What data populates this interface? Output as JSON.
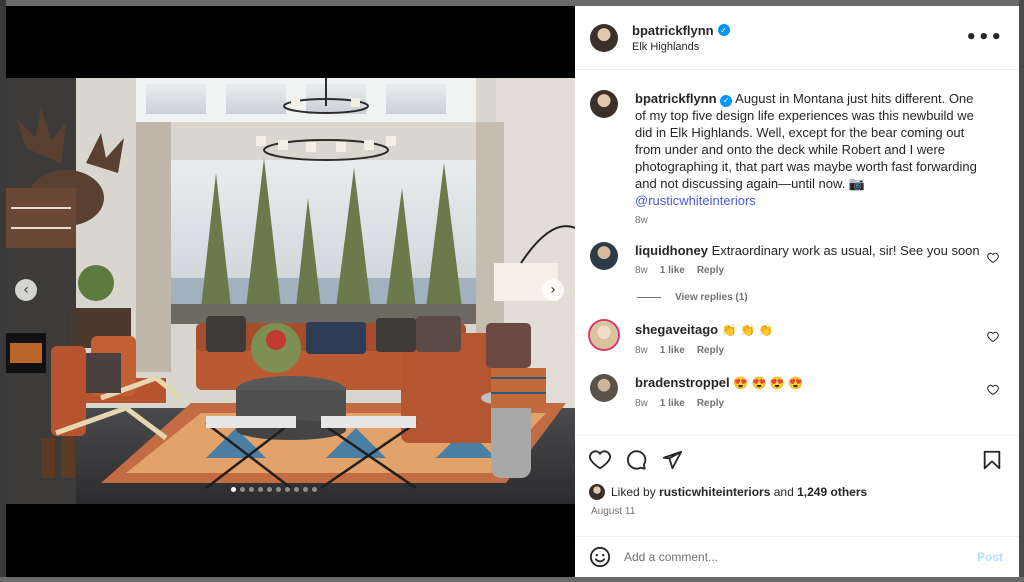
{
  "post": {
    "username": "bpatrickflynn",
    "location": "Elk Highlands",
    "more_icon": "more-horizontal-icon"
  },
  "caption": {
    "username": "bpatrickflynn",
    "text": "August in Montana just hits different. One of my top five design life experiences was this newbuild we did in Elk Highlands. Well, except for the bear coming out from under and onto the deck while Robert and I were photographing it, that part was maybe worth fast forwarding and not discussing again—until now. 📷",
    "mention": "@rusticwhiteinteriors",
    "age": "8w"
  },
  "comments": [
    {
      "username": "liquidhoney",
      "text": "Extraordinary work as usual, sir! See you soon",
      "age": "8w",
      "likes": "1 like",
      "reply": "Reply",
      "view_replies": "View replies (1)"
    },
    {
      "username": "shegaveitago",
      "text": "👏 👏 👏",
      "age": "8w",
      "likes": "1 like",
      "reply": "Reply"
    },
    {
      "username": "bradenstroppel",
      "text": "😍 😍 😍 😍",
      "age": "8w",
      "likes": "1 like",
      "reply": "Reply"
    }
  ],
  "likes": {
    "prefix": "Liked by",
    "user": "rusticwhiteinteriors",
    "middle": "and",
    "others": "1,249 others"
  },
  "date": "August 11",
  "add_comment": {
    "placeholder": "Add a comment...",
    "post_label": "Post"
  },
  "carousel": {
    "prev_glyph": "‹",
    "next_glyph": "›",
    "slide_count": 10,
    "active_slide": 1
  },
  "colors": {
    "accent": "#0095f6",
    "mention": "#4a5ad8",
    "muted": "#737373",
    "post_disabled": "#b2dffc"
  }
}
